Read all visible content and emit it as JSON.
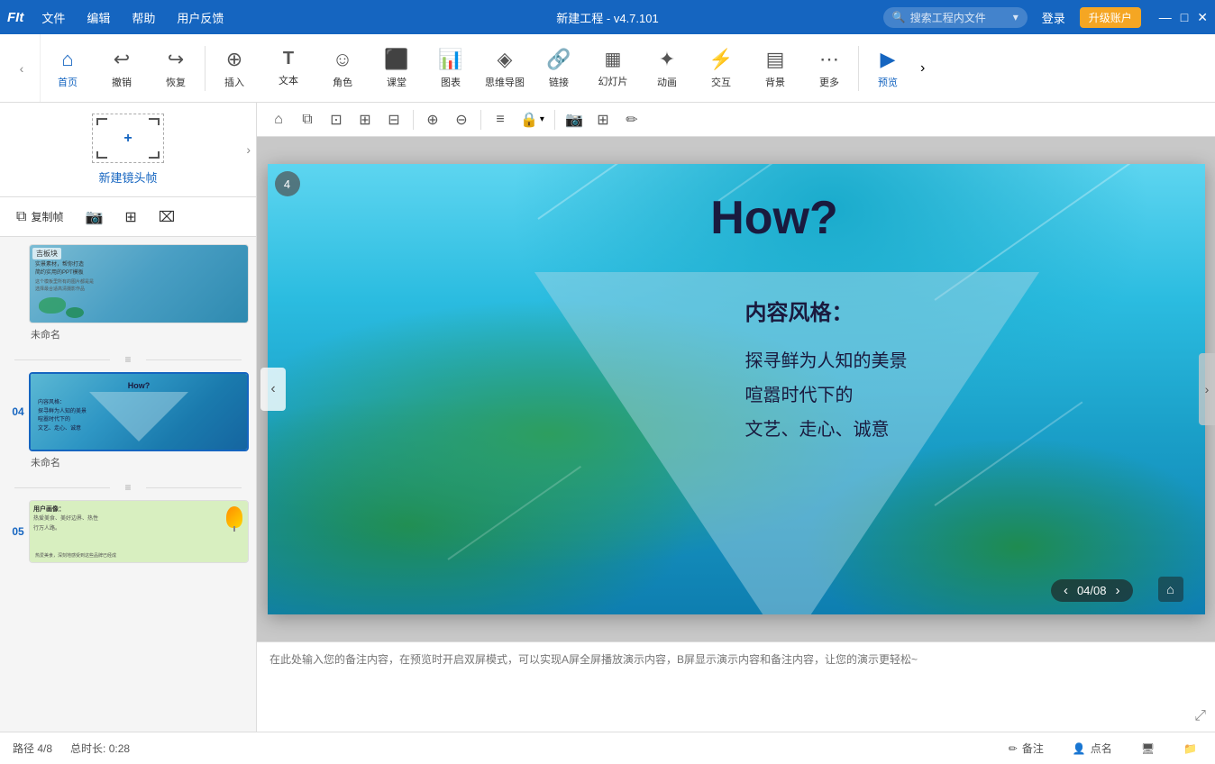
{
  "titlebar": {
    "app_name": "FIt",
    "menu": [
      "文件",
      "编辑",
      "帮助",
      "用户反馈"
    ],
    "title": "新建工程 - v4.7.101",
    "search_placeholder": "搜索工程内文件",
    "login": "登录",
    "upgrade": "升级账户",
    "win_min": "—",
    "win_max": "□",
    "win_close": "✕"
  },
  "toolbar": {
    "nav_back": "‹",
    "nav_forward": "›",
    "items": [
      {
        "id": "home",
        "icon": "⌂",
        "label": "首页"
      },
      {
        "id": "undo",
        "icon": "↩",
        "label": "撤销"
      },
      {
        "id": "redo",
        "icon": "↪",
        "label": "恢复"
      },
      {
        "id": "insert",
        "icon": "+",
        "label": "插入"
      },
      {
        "id": "text",
        "icon": "T",
        "label": "文本"
      },
      {
        "id": "role",
        "icon": "☺",
        "label": "角色"
      },
      {
        "id": "class",
        "icon": "⬛",
        "label": "课堂"
      },
      {
        "id": "chart",
        "icon": "📊",
        "label": "图表"
      },
      {
        "id": "mindmap",
        "icon": "◈",
        "label": "思维导图"
      },
      {
        "id": "link",
        "icon": "🔗",
        "label": "链接"
      },
      {
        "id": "slide",
        "icon": "▦",
        "label": "幻灯片"
      },
      {
        "id": "animation",
        "icon": "✦",
        "label": "动画"
      },
      {
        "id": "interact",
        "icon": "⚡",
        "label": "交互"
      },
      {
        "id": "background",
        "icon": "▤",
        "label": "背景"
      },
      {
        "id": "more",
        "icon": "⋯",
        "label": "更多"
      },
      {
        "id": "preview",
        "icon": "▶",
        "label": "预览"
      }
    ]
  },
  "left_panel": {
    "new_frame_label": "新建镜头帧",
    "frame_controls": [
      {
        "id": "copy",
        "icon": "⧉",
        "label": "复制帧"
      },
      {
        "id": "camera",
        "icon": "📷",
        "label": ""
      },
      {
        "id": "transform",
        "icon": "⊞",
        "label": ""
      },
      {
        "id": "crop",
        "icon": "⌧",
        "label": ""
      }
    ],
    "slides": [
      {
        "number": "",
        "name": "未命名",
        "has_label": true,
        "label": "吉板块",
        "type": "map"
      },
      {
        "number": "04",
        "name": "未命名",
        "active": true,
        "type": "how",
        "badge": null
      },
      {
        "number": "05",
        "name": "",
        "type": "user",
        "partial": true
      }
    ]
  },
  "editor_toolbar": {
    "buttons": [
      {
        "id": "home-et",
        "icon": "⌂"
      },
      {
        "id": "copy-et",
        "icon": "⧉"
      },
      {
        "id": "cut-et",
        "icon": "✂"
      },
      {
        "id": "lock-et",
        "icon": "🔒"
      },
      {
        "id": "lock2-et",
        "icon": "🔐"
      },
      {
        "id": "zoom-in",
        "icon": "🔍+"
      },
      {
        "id": "zoom-out",
        "icon": "🔍-"
      },
      {
        "id": "align-et",
        "icon": "≡"
      },
      {
        "id": "padlock",
        "icon": "🔓"
      },
      {
        "id": "camera2",
        "icon": "📷"
      },
      {
        "id": "grid",
        "icon": "⊞"
      },
      {
        "id": "edit",
        "icon": "✏️"
      }
    ]
  },
  "slide": {
    "title": "How?",
    "content_title": "内容风格：",
    "content_lines": [
      "探寻鲜为人知的美景",
      "喧嚣时代下的",
      "文艺、走心、诚意"
    ],
    "badge_number": "4",
    "counter": "04/08"
  },
  "notes": {
    "placeholder": "在此处输入您的备注内容，在预览时开启双屏模式，可以实现A屏全屏播放演示内容，B屏显示演示内容和备注内容，让您的演示更轻松~"
  },
  "statusbar": {
    "path": "路径 4/8",
    "duration": "总时长: 0:28",
    "backup": "备注",
    "rollcall": "点名",
    "icon1": "🏠",
    "icon2": "👤",
    "icon3": "🖥",
    "icon4": "📁"
  }
}
